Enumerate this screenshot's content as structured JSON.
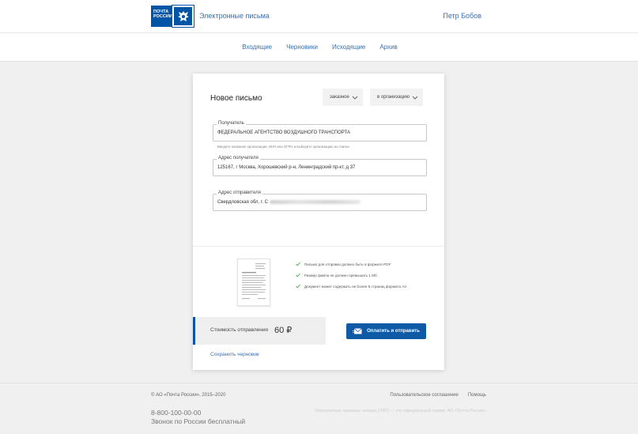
{
  "header": {
    "logo_line1": "ПОЧТА",
    "logo_line2": "РОССИИ",
    "service_title": "Электронные письма",
    "user_name": "Петр Бобов"
  },
  "nav": {
    "items": [
      {
        "label": "Входящие"
      },
      {
        "label": "Черновики"
      },
      {
        "label": "Исходящие"
      },
      {
        "label": "Архив"
      }
    ]
  },
  "form": {
    "title": "Новое письмо",
    "type_select": "заказное",
    "recipient_type_select": "в организацию",
    "recipient": {
      "legend": "Получатель",
      "value": "ФЕДЕРАЛЬНОЕ АГЕНТСТВО ВОЗДУШНОГО ТРАНСПОРТА",
      "hint": "Введите название организации, ИНН или ОГРН и выберите организацию из списка"
    },
    "recipient_address": {
      "legend": "Адрес получателя",
      "value": "125167, г Москва, Хорошевский р-н, Ленинградский пр-кт, д 37"
    },
    "sender_address": {
      "legend": "Адрес отправителя",
      "value": "Свердловская обл, г. С"
    },
    "requirements": [
      {
        "text": "Письмо для отправки должно быть в формате PDF"
      },
      {
        "text": "Размер файла не должен превышать 1 Мб"
      },
      {
        "text": "Документ может содержать не более 5 страниц формата А4"
      }
    ],
    "cost_label": "Стоимость отправления",
    "cost_value": "60 ₽",
    "pay_button": "Оплатить и отправить",
    "save_draft": "Сохранить черновик"
  },
  "footer": {
    "copyright": "© АО «Почта России», 2015–2020",
    "links": [
      {
        "label": "Пользовательское соглашение"
      },
      {
        "label": "Помощь"
      }
    ],
    "phone": "8-800-100-00-00",
    "phone_note": "Звонок по России бесплатный",
    "official": "Электронные заказные письма (ЭЗП) — это официальный сервис АО «Почта России»"
  },
  "colors": {
    "brand_blue": "#0055a6",
    "link_blue": "#3a6fb5",
    "button_blue": "#0e5aa7",
    "check_green": "#4caf50"
  },
  "icons": {
    "emblem": "eagle-emblem-icon",
    "chevron": "chevron-down-icon",
    "check": "check-icon",
    "envelope": "envelope-icon"
  }
}
